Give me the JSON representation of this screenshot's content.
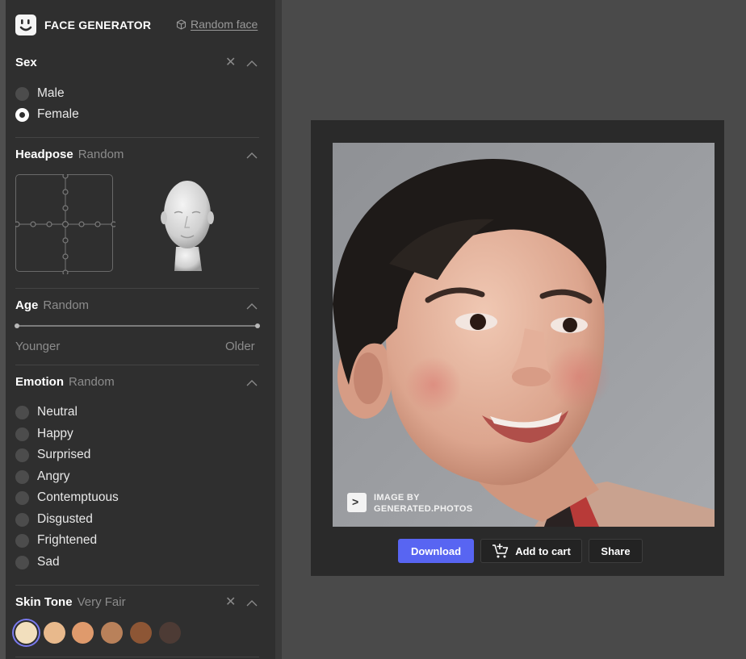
{
  "header": {
    "brand": "FACE GENERATOR",
    "random_link": "Random face"
  },
  "sex": {
    "title": "Sex",
    "options": [
      "Male",
      "Female"
    ],
    "selected": "Female"
  },
  "headpose": {
    "title": "Headpose",
    "value": "Random"
  },
  "age": {
    "title": "Age",
    "value": "Random",
    "min_label": "Younger",
    "max_label": "Older"
  },
  "emotion": {
    "title": "Emotion",
    "value": "Random",
    "options": [
      "Neutral",
      "Happy",
      "Surprised",
      "Angry",
      "Contemptuous",
      "Disgusted",
      "Frightened",
      "Sad"
    ]
  },
  "skin_tone": {
    "title": "Skin Tone",
    "value": "Very Fair",
    "swatches": [
      "#f2dfbd",
      "#e8b98c",
      "#df9a6c",
      "#b9815a",
      "#8d5635",
      "#4d3b35"
    ],
    "selected_index": 0
  },
  "photo": {
    "watermark_line1": "IMAGE BY",
    "watermark_line2": "GENERATED.PHOTOS",
    "watermark_icon": ">"
  },
  "actions": {
    "download": "Download",
    "add_to_cart": "Add to cart",
    "share": "Share"
  },
  "colors": {
    "accent": "#5865f2",
    "panel": "#2f2f2f",
    "selected_ring": "#7a7aee"
  }
}
